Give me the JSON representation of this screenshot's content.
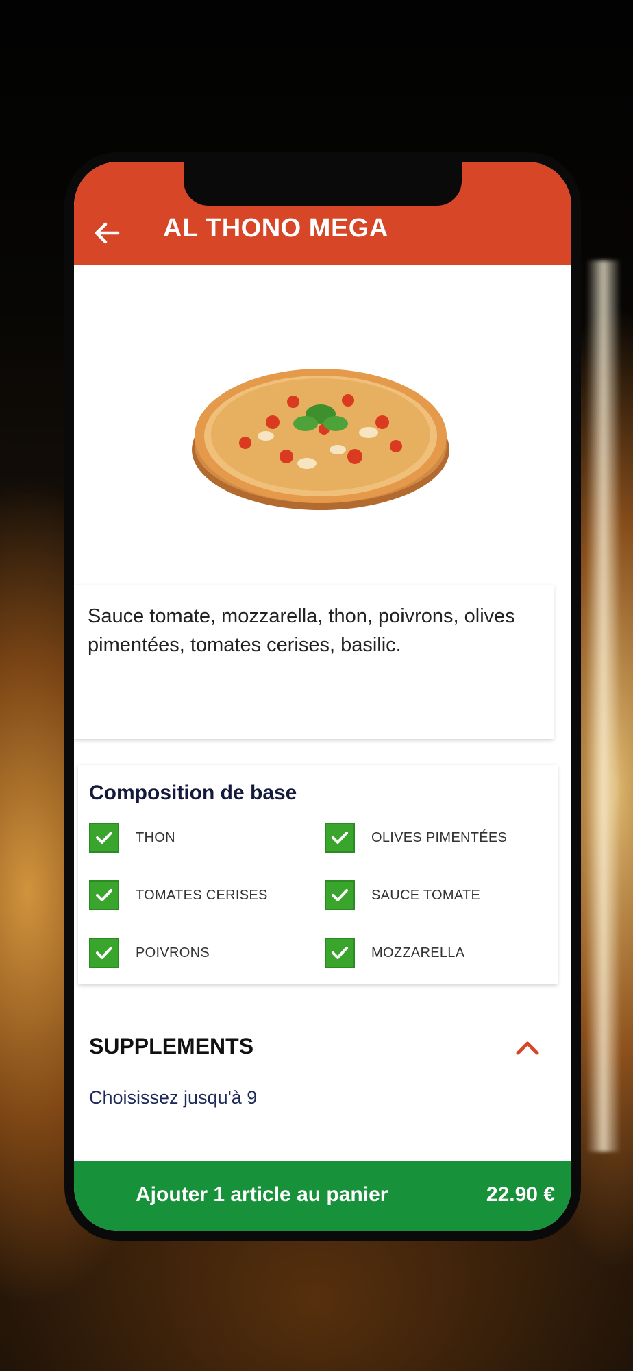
{
  "header": {
    "title": "AL THONO MEGA",
    "back_icon": "arrow-left-icon"
  },
  "product": {
    "image_icon": "pizza-image",
    "description": "Sauce tomate, mozzarella, thon, poivrons, olives pimentées, tomates cerises, basilic."
  },
  "composition": {
    "title": "Composition de base",
    "items": [
      {
        "label": "THON",
        "checked": true
      },
      {
        "label": "OLIVES PIMENTÉES",
        "checked": true
      },
      {
        "label": "TOMATES CERISES",
        "checked": true
      },
      {
        "label": "SAUCE TOMATE",
        "checked": true
      },
      {
        "label": "POIVRONS",
        "checked": true
      },
      {
        "label": "MOZZARELLA",
        "checked": true
      }
    ]
  },
  "supplements": {
    "title": "SUPPLEMENTS",
    "subtitle": "Choisissez jusqu'à 9",
    "toggle_icon": "chevron-up-icon"
  },
  "cart": {
    "label": "Ajouter 1 article au panier",
    "price": "22.90 €"
  },
  "colors": {
    "header": "#d64627",
    "checkbox": "#3aa52d",
    "cart_bar": "#17913a",
    "title_text": "#141a3c"
  }
}
